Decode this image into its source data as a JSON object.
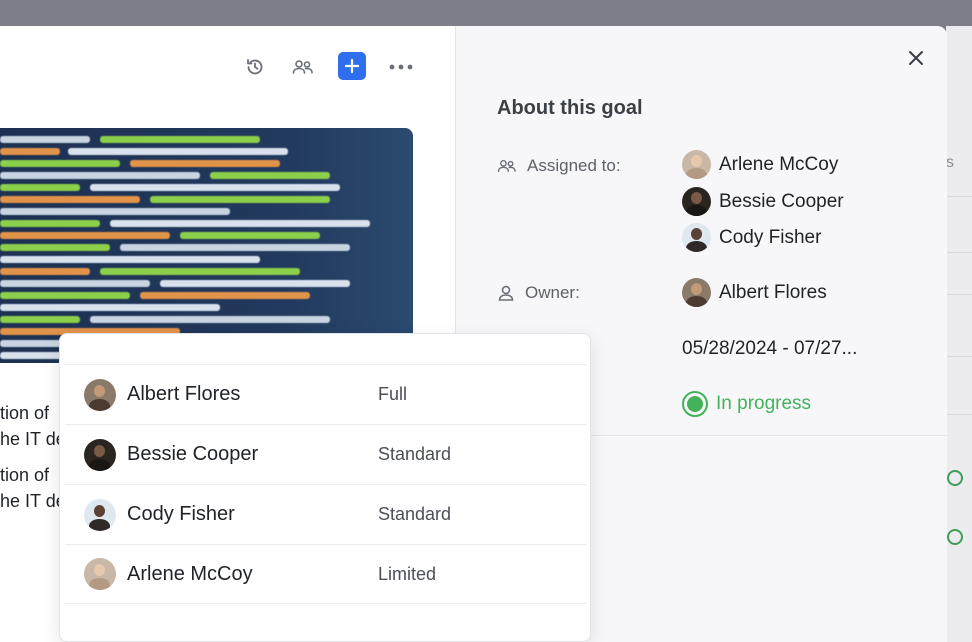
{
  "toolbar": {
    "history_icon": "history-icon",
    "members_icon": "people-icon",
    "add_icon": "plus-icon",
    "more_icon": "ellipsis-icon",
    "accent": "#2f6fed"
  },
  "body_text": {
    "fragments": [
      "tion of",
      "he IT de",
      "tion of",
      "he IT de"
    ]
  },
  "about": {
    "title": "About this goal",
    "assigned_label": "Assigned to:",
    "owner_label": "Owner:",
    "assignees": [
      "Arlene McCoy",
      "Bessie Cooper",
      "Cody Fisher"
    ],
    "owner": "Albert Flores",
    "date_range": "05/28/2024 - 07/27...",
    "status": "In progress",
    "status_color": "#44b25a"
  },
  "members_popover": {
    "rows": [
      {
        "name": "Albert Flores",
        "permission": "Full"
      },
      {
        "name": "Bessie Cooper",
        "permission": "Standard"
      },
      {
        "name": "Cody Fisher",
        "permission": "Standard"
      },
      {
        "name": "Arlene McCoy",
        "permission": "Limited"
      }
    ]
  },
  "backdrop": {
    "letter": "s"
  }
}
